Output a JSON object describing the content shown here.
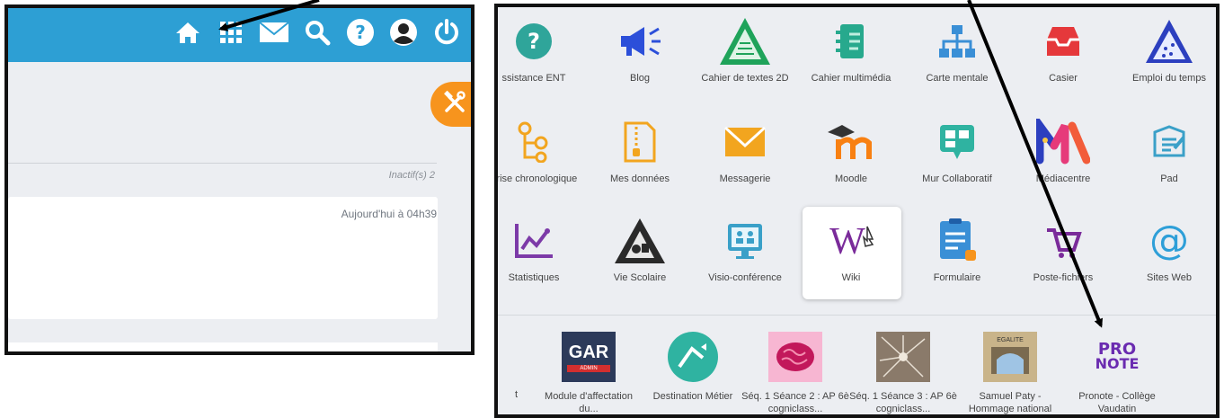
{
  "left": {
    "inactive_label": "Inactif(s) 2",
    "card_time": "Aujourd'hui à 04h39",
    "topbar_icons": [
      "home-icon",
      "apps-grid-icon",
      "mail-icon",
      "search-icon",
      "help-icon",
      "user-icon",
      "power-icon"
    ],
    "accent": "#2d9fd4",
    "fab_color": "#f7941d"
  },
  "apps": [
    {
      "name": "assistance-ent",
      "label": "ssistance ENT",
      "icon": "question-circle-icon"
    },
    {
      "name": "blog",
      "label": "Blog",
      "icon": "megaphone-icon"
    },
    {
      "name": "cahier-de-textes",
      "label": "Cahier de textes 2D",
      "icon": "cahier-textes-icon"
    },
    {
      "name": "cahier-multimedia",
      "label": "Cahier multimédia",
      "icon": "cahier-multimedia-icon"
    },
    {
      "name": "carte-mentale",
      "label": "Carte mentale",
      "icon": "mindmap-icon"
    },
    {
      "name": "casier",
      "label": "Casier",
      "icon": "inbox-tray-icon"
    },
    {
      "name": "emploi-du-temps",
      "label": "Emploi du temps",
      "icon": "timetable-icon"
    },
    {
      "name": "frise-chronologique",
      "label": "Frise chronologique",
      "icon": "timeline-icon"
    },
    {
      "name": "mes-donnees",
      "label": "Mes données",
      "icon": "zip-file-icon"
    },
    {
      "name": "messagerie",
      "label": "Messagerie",
      "icon": "envelope-icon"
    },
    {
      "name": "moodle",
      "label": "Moodle",
      "icon": "moodle-icon"
    },
    {
      "name": "mur-collaboratif",
      "label": "Mur Collaboratif",
      "icon": "board-icon"
    },
    {
      "name": "mediacentre",
      "label": "Médiacentre",
      "icon": "mediacentre-icon"
    },
    {
      "name": "pad",
      "label": "Pad",
      "icon": "pad-icon"
    },
    {
      "name": "statistiques",
      "label": "Statistiques",
      "icon": "line-chart-icon"
    },
    {
      "name": "vie-scolaire",
      "label": "Vie Scolaire",
      "icon": "vie-scolaire-icon"
    },
    {
      "name": "visio-conference",
      "label": "Visio-conférence",
      "icon": "video-conference-icon"
    },
    {
      "name": "wiki",
      "label": "Wiki",
      "icon": "wiki-icon"
    },
    {
      "name": "formulaire",
      "label": "Formulaire",
      "icon": "form-icon"
    },
    {
      "name": "poste-fichiers",
      "label": "Poste-fichiers",
      "icon": "cart-icon"
    },
    {
      "name": "sites-web",
      "label": "Sites Web",
      "icon": "at-sign-icon"
    }
  ],
  "resources": [
    {
      "name": "gar",
      "label": "Module d'affectation du...",
      "badge": "GAR",
      "sub": "ADMIN"
    },
    {
      "name": "destination-metier",
      "label": "Destination Métier"
    },
    {
      "name": "seq1-seance2",
      "label": "Séq. 1 Séance 2 : AP 6è cogniclass..."
    },
    {
      "name": "seq1-seance3",
      "label": "Séq. 1 Séance 3 : AP 6è cogniclass..."
    },
    {
      "name": "samuel-paty",
      "label": "Samuel Paty - Hommage national",
      "sign": "EGALITE"
    },
    {
      "name": "pronote",
      "label": "Pronote - Collège Vaudatin",
      "logo_line1": "PRO",
      "logo_line2": "NOTE"
    }
  ],
  "resource_partial_label": "t"
}
